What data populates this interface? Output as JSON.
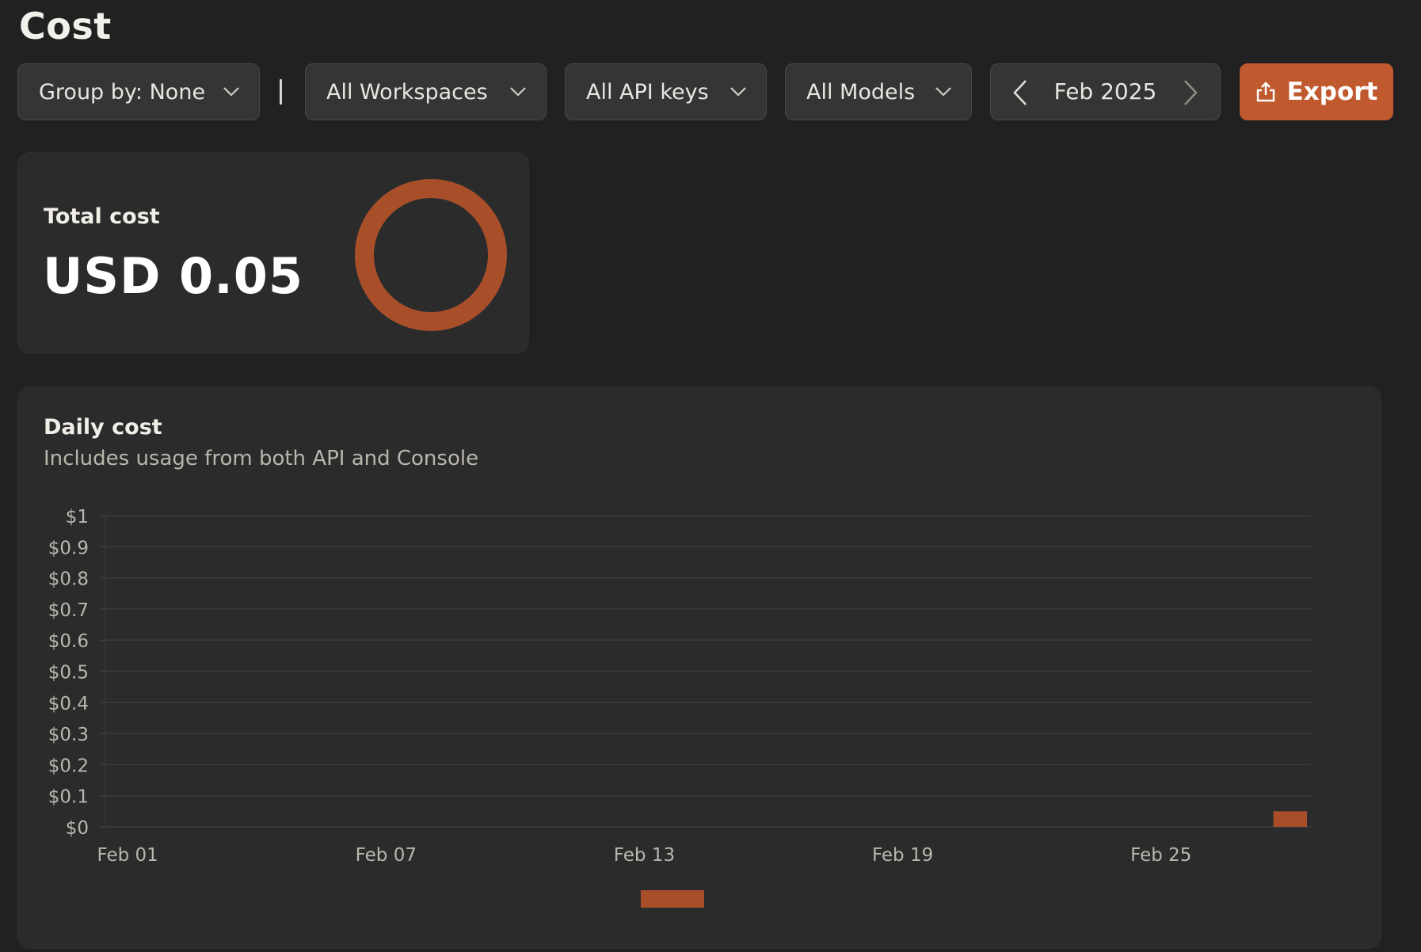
{
  "page": {
    "title": "Cost"
  },
  "toolbar": {
    "group_by": "Group by: None",
    "workspaces": "All Workspaces",
    "api_keys": "All API keys",
    "models": "All Models",
    "date": "Feb 2025",
    "export_label": "Export"
  },
  "total": {
    "label": "Total cost",
    "value": "USD 0.05"
  },
  "daily": {
    "title": "Daily cost",
    "subtitle": "Includes usage from both API and Console"
  },
  "colors": {
    "accent": "#c05a2e",
    "bar": "#a84f2a",
    "grid": "#3c3c3c"
  },
  "chart_data": {
    "type": "bar",
    "y_tick_labels": [
      "$0",
      "$0.1",
      "$0.2",
      "$0.3",
      "$0.4",
      "$0.5",
      "$0.6",
      "$0.7",
      "$0.8",
      "$0.9",
      "$1"
    ],
    "x_tick_labels": [
      "Feb 01",
      "Feb 07",
      "Feb 13",
      "Feb 19",
      "Feb 25"
    ],
    "x": [
      "Feb 01",
      "Feb 02",
      "Feb 03",
      "Feb 04",
      "Feb 05",
      "Feb 06",
      "Feb 07",
      "Feb 08",
      "Feb 09",
      "Feb 10",
      "Feb 11",
      "Feb 12",
      "Feb 13",
      "Feb 14",
      "Feb 15",
      "Feb 16",
      "Feb 17",
      "Feb 18",
      "Feb 19",
      "Feb 20",
      "Feb 21",
      "Feb 22",
      "Feb 23",
      "Feb 24",
      "Feb 25",
      "Feb 26",
      "Feb 27",
      "Feb 28"
    ],
    "values": [
      0,
      0,
      0,
      0,
      0,
      0,
      0,
      0,
      0,
      0,
      0,
      0,
      0,
      0,
      0,
      0,
      0,
      0,
      0,
      0,
      0,
      0,
      0,
      0,
      0,
      0,
      0,
      0.05
    ],
    "ylim": [
      0,
      1
    ],
    "grid": true,
    "legend": "bottom-center"
  }
}
